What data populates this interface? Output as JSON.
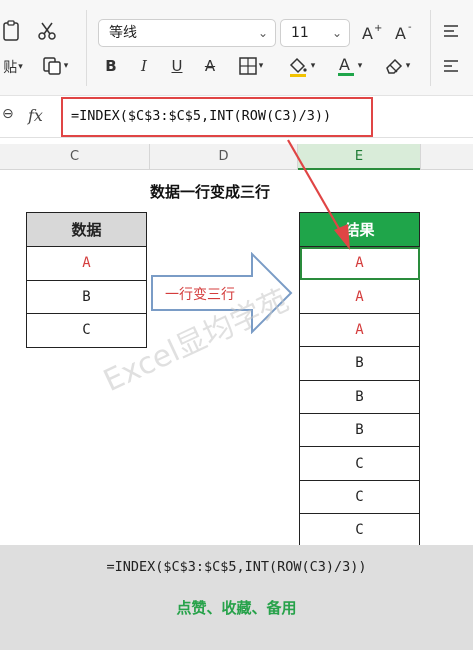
{
  "ribbon": {
    "font_name": "等线",
    "font_size": "11",
    "paste_label": "贴",
    "bold_label": "B",
    "italic_label": "I",
    "underline_label": "U",
    "strike_label": "A"
  },
  "formula_bar": {
    "fx_label": "fx",
    "formula": "=INDEX($C$3:$C$5,INT(ROW(C3)/3))"
  },
  "columns": [
    "C",
    "D",
    "E"
  ],
  "sheet": {
    "title": "数据一行变成三行",
    "left_table": {
      "header": "数据",
      "rows": [
        "A",
        "B",
        "C"
      ]
    },
    "arrow_label": "一行变三行",
    "right_table": {
      "header": "结果",
      "rows": [
        "A",
        "A",
        "A",
        "B",
        "B",
        "B",
        "C",
        "C",
        "C"
      ]
    },
    "watermark": "Excel显均学苑"
  },
  "footer": {
    "formula": "=INDEX($C$3:$C$5,INT(ROW(C3)/3))",
    "caption": "点赞、收藏、备用"
  },
  "colors": {
    "accent_green": "#1fa54a",
    "highlight_red": "#d43c3c",
    "header_gray": "#d8d8d8"
  }
}
